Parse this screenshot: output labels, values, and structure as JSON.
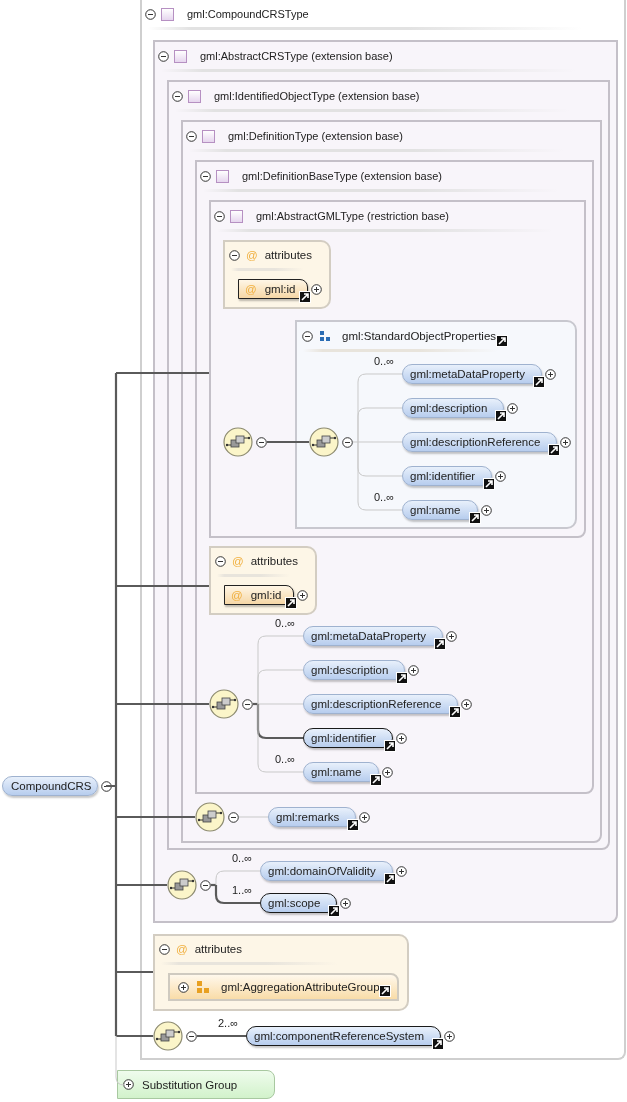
{
  "root_element": {
    "name": "CompoundCRS",
    "expanded": true
  },
  "type": {
    "title": "gml:CompoundCRSType",
    "expanded": true,
    "attributes": {
      "icon": "@",
      "label": "attributes",
      "expanded": true,
      "items": [
        {
          "kind": "attribute_group",
          "name": "gml:AggregationAttributeGroup",
          "expanded": false
        }
      ]
    },
    "sequences": [
      {
        "expanded": true,
        "elements": [
          {
            "name": "gml:componentReferenceSystem",
            "cardinality": "2..∞",
            "required": true,
            "expanded": false
          }
        ]
      }
    ],
    "base": {
      "title": "gml:AbstractCRSType (extension base)",
      "expanded": true,
      "sequences": [
        {
          "expanded": true,
          "elements": [
            {
              "name": "gml:domainOfValidity",
              "cardinality": "0..∞",
              "required": false,
              "expanded": false
            },
            {
              "name": "gml:scope",
              "cardinality": "1..∞",
              "required": true,
              "expanded": false
            }
          ]
        }
      ],
      "base": {
        "title": "gml:IdentifiedObjectType (extension base)",
        "expanded": true,
        "base": {
          "title": "gml:DefinitionType (extension base)",
          "expanded": true,
          "sequences": [
            {
              "expanded": true,
              "elements": [
                {
                  "name": "gml:remarks",
                  "required": false,
                  "expanded": false
                }
              ]
            }
          ],
          "base": {
            "title": "gml:DefinitionBaseType (extension base)",
            "expanded": true,
            "attributes": {
              "icon": "@",
              "label": "attributes",
              "expanded": true,
              "items": [
                {
                  "kind": "attribute",
                  "icon": "@",
                  "name": "gml:id",
                  "expanded": false
                }
              ]
            },
            "sequences": [
              {
                "expanded": true,
                "elements": [
                  {
                    "name": "gml:metaDataProperty",
                    "cardinality": "0..∞",
                    "required": false,
                    "expanded": false
                  },
                  {
                    "name": "gml:description",
                    "required": false,
                    "expanded": false
                  },
                  {
                    "name": "gml:descriptionReference",
                    "required": false,
                    "expanded": false
                  },
                  {
                    "name": "gml:identifier",
                    "required": true,
                    "expanded": false
                  },
                  {
                    "name": "gml:name",
                    "cardinality": "0..∞",
                    "required": false,
                    "expanded": false
                  }
                ]
              }
            ],
            "base": {
              "title": "gml:AbstractGMLType (restriction base)",
              "expanded": true,
              "attributes": {
                "icon": "@",
                "label": "attributes",
                "expanded": true,
                "items": [
                  {
                    "kind": "attribute",
                    "icon": "@",
                    "name": "gml:id",
                    "expanded": false
                  }
                ]
              },
              "sequences": [
                {
                  "expanded": true,
                  "group": {
                    "name": "gml:StandardObjectProperties",
                    "expanded": true,
                    "sequence": {
                      "expanded": true,
                      "elements": [
                        {
                          "name": "gml:metaDataProperty",
                          "cardinality": "0..∞",
                          "required": false,
                          "expanded": false
                        },
                        {
                          "name": "gml:description",
                          "required": false,
                          "expanded": false
                        },
                        {
                          "name": "gml:descriptionReference",
                          "required": false,
                          "expanded": false
                        },
                        {
                          "name": "gml:identifier",
                          "required": false,
                          "expanded": false
                        },
                        {
                          "name": "gml:name",
                          "cardinality": "0..∞",
                          "required": false,
                          "expanded": false
                        }
                      ]
                    }
                  }
                }
              ]
            }
          }
        }
      }
    }
  },
  "substitution_group": {
    "label": "Substitution Group",
    "expanded": false
  }
}
